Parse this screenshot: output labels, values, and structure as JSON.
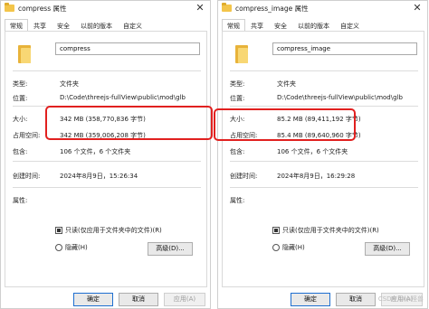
{
  "left": {
    "title": "compress 属性",
    "tabs": [
      "常规",
      "共享",
      "安全",
      "以前的版本",
      "自定义"
    ],
    "name": "compress",
    "rows": {
      "type": {
        "label": "类型:",
        "value": "文件夹"
      },
      "location": {
        "label": "位置:",
        "value": "D:\\Code\\threejs-fullView\\public\\mod\\glb"
      },
      "size": {
        "label": "大小:",
        "value": "342 MB (358,770,836 字节)"
      },
      "disk": {
        "label": "占用空间:",
        "value": "342 MB (359,006,208 字节)"
      },
      "contains": {
        "label": "包含:",
        "value": "106 个文件，6 个文件夹"
      },
      "created": {
        "label": "创建时间:",
        "value": "2024年8月9日，15:26:34"
      },
      "attrs": {
        "label": "属性:"
      }
    },
    "readonly_label": "只读(仅应用于文件夹中的文件)(R)",
    "hidden_label": "隐藏(H)",
    "advanced": "高级(D)...",
    "ok": "确定",
    "cancel": "取消",
    "apply": "应用(A)"
  },
  "right": {
    "title": "compress_image 属性",
    "tabs": [
      "常规",
      "共享",
      "安全",
      "以前的版本",
      "自定义"
    ],
    "name": "compress_image",
    "rows": {
      "type": {
        "label": "类型:",
        "value": "文件夹"
      },
      "location": {
        "label": "位置:",
        "value": "D:\\Code\\threejs-fullView\\public\\mod\\glb"
      },
      "size": {
        "label": "大小:",
        "value": "85.2 MB (89,411,192 字节)"
      },
      "disk": {
        "label": "占用空间:",
        "value": "85.4 MB (89,640,960 字节)"
      },
      "contains": {
        "label": "包含:",
        "value": "106 个文件，6 个文件夹"
      },
      "created": {
        "label": "创建时间:",
        "value": "2024年8月9日，16:29:28"
      },
      "attrs": {
        "label": "属性:"
      }
    },
    "readonly_label": "只读(仅应用于文件夹中的文件)(R)",
    "hidden_label": "隐藏(H)",
    "advanced": "高级(D)...",
    "ok": "确定",
    "cancel": "取消",
    "apply": "应用(A)"
  },
  "watermark": "CSDN @小怪兽",
  "highlight_color": "#e1201f"
}
